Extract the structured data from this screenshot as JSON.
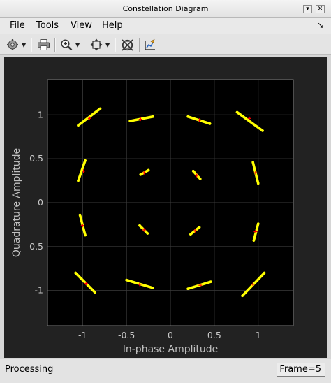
{
  "window": {
    "title": "Constellation Diagram",
    "minimize_glyph": "▾",
    "close_glyph": "✕"
  },
  "menu": {
    "items": [
      {
        "label": "File",
        "accel": "F",
        "rest": "ile"
      },
      {
        "label": "Tools",
        "accel": "T",
        "rest": "ools"
      },
      {
        "label": "View",
        "accel": "V",
        "rest": "iew"
      },
      {
        "label": "Help",
        "accel": "H",
        "rest": "elp"
      }
    ],
    "dock_glyph": "↘"
  },
  "toolbar": {
    "icons": [
      "gear-icon",
      "print-icon",
      "zoom-in-icon",
      "fit-to-view-icon",
      "reference-constellation-icon",
      "edit-properties-icon"
    ]
  },
  "plot": {
    "background": "#000000",
    "grid_color": "#3a3a3a",
    "series_colors": {
      "received": "#ffff00",
      "reference": "#ff0000"
    }
  },
  "chart_data": {
    "type": "scatter",
    "title": "",
    "xlabel": "In-phase Amplitude",
    "ylabel": "Quadrature Amplitude",
    "xlim": [
      -1.4,
      1.4
    ],
    "ylim": [
      -1.4,
      1.4
    ],
    "x_ticks": [
      -1,
      -0.5,
      0,
      0.5,
      1
    ],
    "x_tick_labels": [
      "-1",
      "-0.5",
      "0",
      "0.5",
      "1"
    ],
    "y_ticks": [
      1,
      0.5,
      0,
      -0.5,
      -1
    ],
    "y_tick_labels": [
      "1",
      "0.5",
      "0",
      "-0.5",
      "-1"
    ],
    "grid": true,
    "series": [
      {
        "kind": "received-arcs",
        "arcs": [
          {
            "from": [
              -1.05,
              0.88
            ],
            "to": [
              -0.8,
              1.07
            ]
          },
          {
            "from": [
              -0.46,
              0.93
            ],
            "to": [
              -0.2,
              0.98
            ]
          },
          {
            "from": [
              0.2,
              0.98
            ],
            "to": [
              0.45,
              0.9
            ]
          },
          {
            "from": [
              0.76,
              1.03
            ],
            "to": [
              1.05,
              0.82
            ]
          },
          {
            "from": [
              -1.05,
              0.25
            ],
            "to": [
              -0.97,
              0.48
            ]
          },
          {
            "from": [
              -0.34,
              0.32
            ],
            "to": [
              -0.25,
              0.37
            ]
          },
          {
            "from": [
              0.26,
              0.36
            ],
            "to": [
              0.34,
              0.27
            ]
          },
          {
            "from": [
              0.94,
              0.46
            ],
            "to": [
              1.0,
              0.22
            ]
          },
          {
            "from": [
              -1.03,
              -0.14
            ],
            "to": [
              -0.97,
              -0.37
            ]
          },
          {
            "from": [
              -0.35,
              -0.26
            ],
            "to": [
              -0.26,
              -0.35
            ]
          },
          {
            "from": [
              0.23,
              -0.36
            ],
            "to": [
              0.33,
              -0.28
            ]
          },
          {
            "from": [
              0.95,
              -0.43
            ],
            "to": [
              1.0,
              -0.24
            ]
          },
          {
            "from": [
              -1.08,
              -0.8
            ],
            "to": [
              -0.86,
              -1.02
            ]
          },
          {
            "from": [
              -0.5,
              -0.88
            ],
            "to": [
              -0.2,
              -0.97
            ]
          },
          {
            "from": [
              0.2,
              -0.98
            ],
            "to": [
              0.46,
              -0.9
            ]
          },
          {
            "from": [
              0.82,
              -1.06
            ],
            "to": [
              1.07,
              -0.8
            ]
          }
        ]
      },
      {
        "kind": "reference-points",
        "points": [
          [
            -0.92,
            0.96
          ],
          [
            -0.34,
            0.95
          ],
          [
            0.33,
            0.94
          ],
          [
            0.9,
            0.96
          ],
          [
            -0.99,
            0.36
          ],
          [
            -0.3,
            0.34
          ],
          [
            0.3,
            0.31
          ],
          [
            0.97,
            0.34
          ],
          [
            -1.0,
            -0.26
          ],
          [
            -0.3,
            -0.31
          ],
          [
            0.28,
            -0.32
          ],
          [
            0.97,
            -0.33
          ],
          [
            -0.96,
            -0.92
          ],
          [
            -0.35,
            -0.93
          ],
          [
            0.34,
            -0.94
          ],
          [
            0.94,
            -0.93
          ]
        ]
      }
    ]
  },
  "status": {
    "text": "Processing",
    "frame": "Frame=5"
  }
}
